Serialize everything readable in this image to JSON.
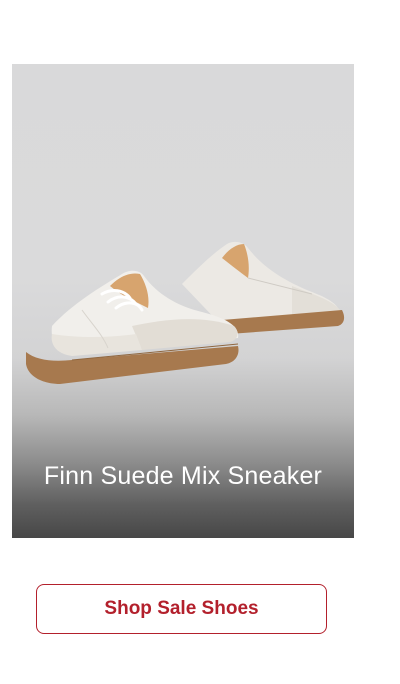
{
  "product": {
    "name": "Finn Suede Mix Sneaker"
  },
  "cta": {
    "label": "Shop Sale Shoes",
    "color": "#b3202c"
  },
  "icons": [
    "sneaker-pair-image"
  ]
}
